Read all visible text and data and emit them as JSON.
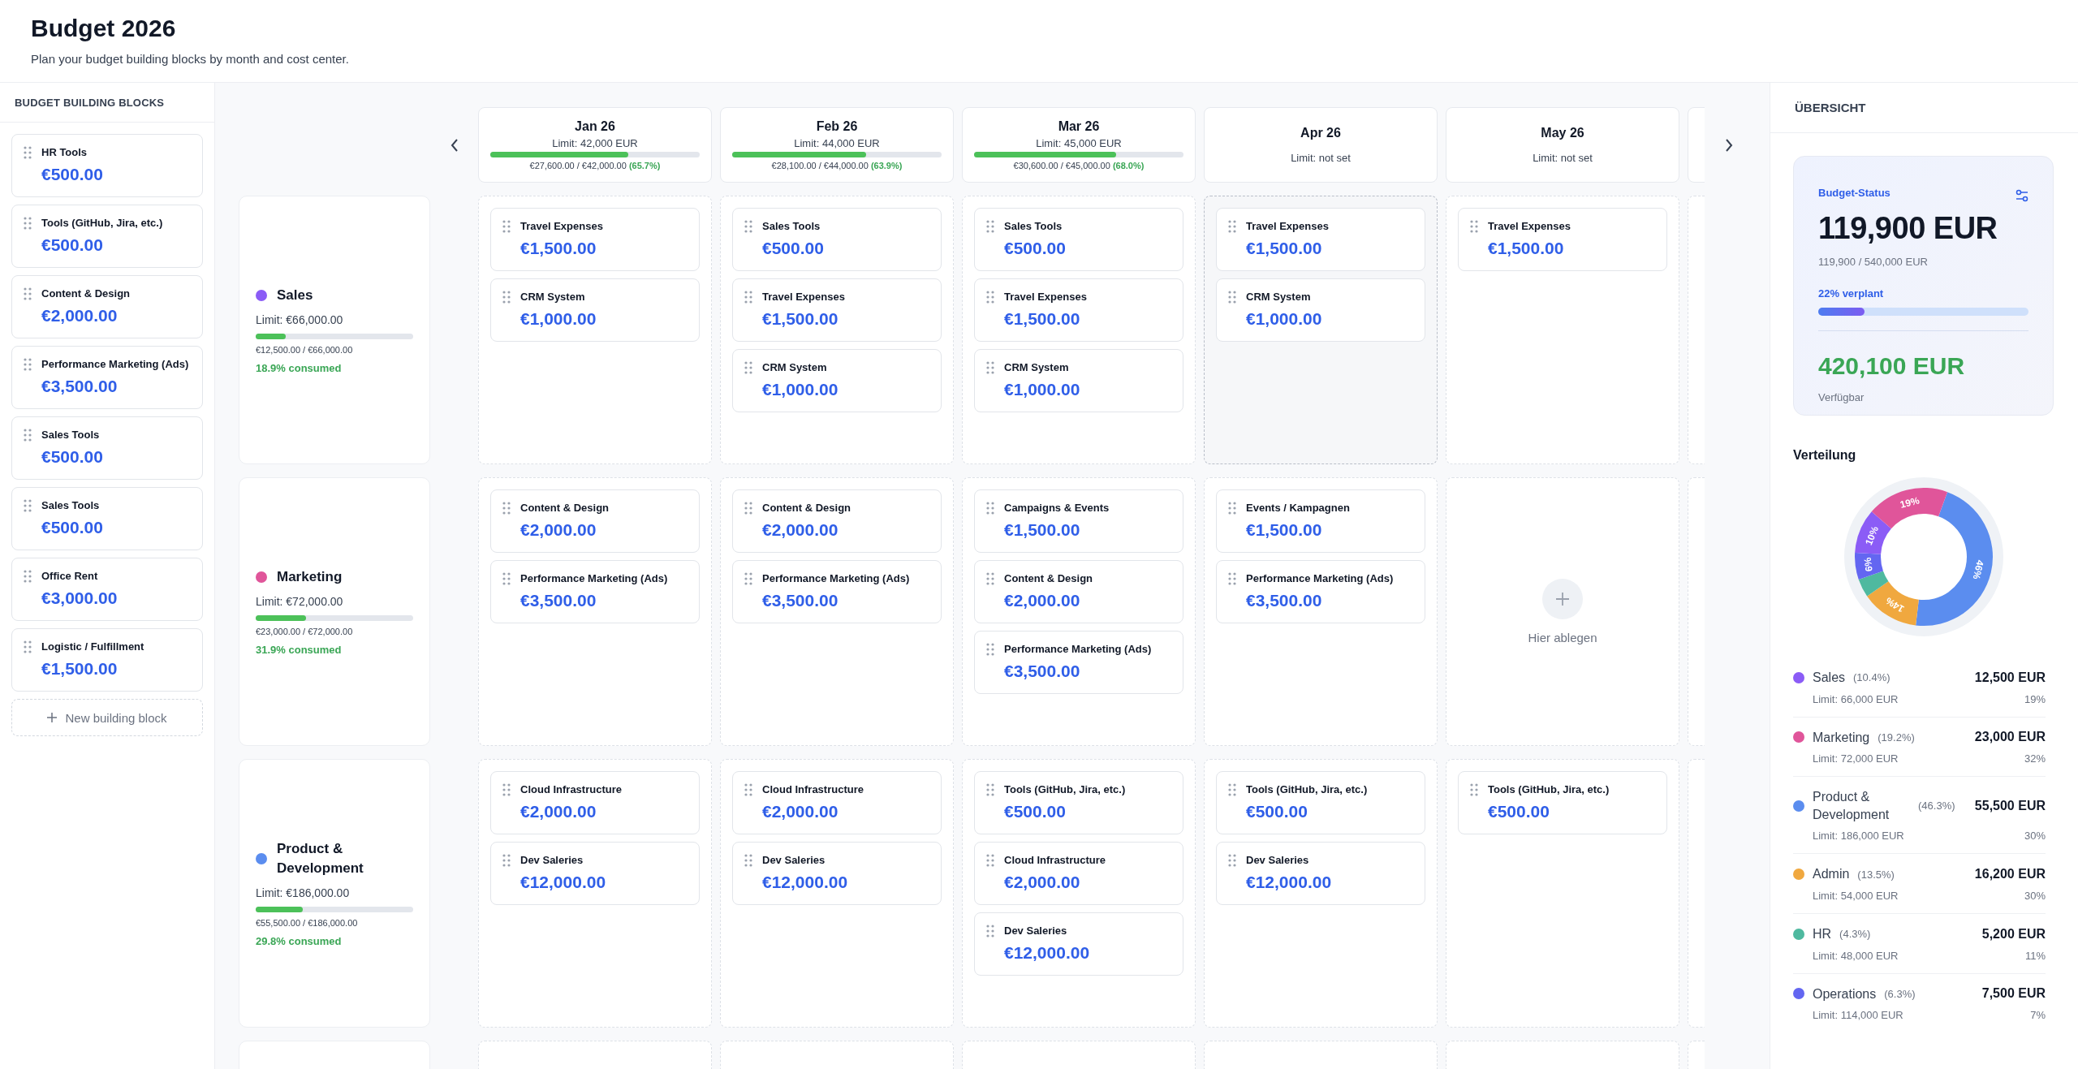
{
  "page": {
    "title": "Budget 2026",
    "subtitle": "Plan your budget building blocks by month and cost center."
  },
  "sidebar": {
    "title": "BUDGET BUILDING BLOCKS",
    "blocks": [
      {
        "label": "HR Tools",
        "amount": "€500.00"
      },
      {
        "label": "Tools (GitHub, Jira, etc.)",
        "amount": "€500.00"
      },
      {
        "label": "Content & Design",
        "amount": "€2,000.00"
      },
      {
        "label": "Performance Marketing (Ads)",
        "amount": "€3,500.00"
      },
      {
        "label": "Sales Tools",
        "amount": "€500.00"
      },
      {
        "label": "Sales Tools",
        "amount": "€500.00"
      },
      {
        "label": "Office Rent",
        "amount": "€3,000.00"
      },
      {
        "label": "Logistic / Fulfillment",
        "amount": "€1,500.00"
      }
    ],
    "new_button": "New building block"
  },
  "months": [
    {
      "title": "Jan 26",
      "limit": "Limit: 42,000 EUR",
      "level": 0.657,
      "reading": "€27,600.00 / €42,000.00",
      "percent": "(65.7%)"
    },
    {
      "title": "Feb 26",
      "limit": "Limit: 44,000 EUR",
      "level": 0.639,
      "reading": "€28,100.00 / €44,000.00",
      "percent": "(63.9%)"
    },
    {
      "title": "Mar 26",
      "limit": "Limit: 45,000 EUR",
      "level": 0.68,
      "reading": "€30,600.00 / €45,000.00",
      "percent": "(68.0%)"
    },
    {
      "title": "Apr 26",
      "limit": "Limit: not set"
    },
    {
      "title": "May 26",
      "limit": "Limit: not set"
    }
  ],
  "rows": [
    {
      "name": "Sales",
      "color": "#8b5cf6",
      "limit": "Limit: €66,000.00",
      "level": 0.189,
      "reading": "€12,500.00 / €66,000.00",
      "consumed": "18.9% consumed",
      "cells": [
        {
          "highlighted": false,
          "blocks": [
            {
              "label": "Travel Expenses",
              "amount": "€1,500.00"
            },
            {
              "label": "CRM System",
              "amount": "€1,000.00"
            }
          ]
        },
        {
          "highlighted": false,
          "blocks": [
            {
              "label": "Sales Tools",
              "amount": "€500.00"
            },
            {
              "label": "Travel Expenses",
              "amount": "€1,500.00"
            },
            {
              "label": "CRM System",
              "amount": "€1,000.00"
            }
          ]
        },
        {
          "highlighted": false,
          "blocks": [
            {
              "label": "Sales Tools",
              "amount": "€500.00"
            },
            {
              "label": "Travel Expenses",
              "amount": "€1,500.00"
            },
            {
              "label": "CRM System",
              "amount": "€1,000.00"
            }
          ]
        },
        {
          "highlighted": true,
          "blocks": [
            {
              "label": "Travel Expenses",
              "amount": "€1,500.00"
            },
            {
              "label": "CRM System",
              "amount": "€1,000.00"
            }
          ]
        },
        {
          "highlighted": false,
          "blocks": [
            {
              "label": "Travel Expenses",
              "amount": "€1,500.00"
            }
          ]
        }
      ]
    },
    {
      "name": "Marketing",
      "color": "#e0559a",
      "limit": "Limit: €72,000.00",
      "level": 0.319,
      "reading": "€23,000.00 / €72,000.00",
      "consumed": "31.9% consumed",
      "cells": [
        {
          "highlighted": false,
          "blocks": [
            {
              "label": "Content & Design",
              "amount": "€2,000.00"
            },
            {
              "label": "Performance Marketing (Ads)",
              "amount": "€3,500.00"
            }
          ]
        },
        {
          "highlighted": false,
          "blocks": [
            {
              "label": "Content & Design",
              "amount": "€2,000.00"
            },
            {
              "label": "Performance Marketing (Ads)",
              "amount": "€3,500.00"
            }
          ]
        },
        {
          "highlighted": false,
          "blocks": [
            {
              "label": "Campaigns & Events",
              "amount": "€1,500.00"
            },
            {
              "label": "Content & Design",
              "amount": "€2,000.00"
            },
            {
              "label": "Performance Marketing (Ads)",
              "amount": "€3,500.00"
            }
          ]
        },
        {
          "highlighted": false,
          "blocks": [
            {
              "label": "Events / Kampagnen",
              "amount": "€1,500.00"
            },
            {
              "label": "Performance Marketing (Ads)",
              "amount": "€3,500.00"
            }
          ]
        },
        {
          "highlighted": false,
          "hint": "Hier ablegen"
        }
      ]
    },
    {
      "name": "Product & Development",
      "color": "#5b8def",
      "limit": "Limit: €186,000.00",
      "level": 0.298,
      "reading": "€55,500.00 / €186,000.00",
      "consumed": "29.8% consumed",
      "cells": [
        {
          "highlighted": false,
          "blocks": [
            {
              "label": "Cloud Infrastructure",
              "amount": "€2,000.00"
            },
            {
              "label": "Dev Saleries",
              "amount": "€12,000.00"
            }
          ]
        },
        {
          "highlighted": false,
          "blocks": [
            {
              "label": "Cloud Infrastructure",
              "amount": "€2,000.00"
            },
            {
              "label": "Dev Saleries",
              "amount": "€12,000.00"
            }
          ]
        },
        {
          "highlighted": false,
          "blocks": [
            {
              "label": "Tools (GitHub, Jira, etc.)",
              "amount": "€500.00"
            },
            {
              "label": "Cloud Infrastructure",
              "amount": "€2,000.00"
            },
            {
              "label": "Dev Saleries",
              "amount": "€12,000.00"
            }
          ]
        },
        {
          "highlighted": false,
          "blocks": [
            {
              "label": "Tools (GitHub, Jira, etc.)",
              "amount": "€500.00"
            },
            {
              "label": "Dev Saleries",
              "amount": "€12,000.00"
            }
          ]
        },
        {
          "highlighted": false,
          "blocks": [
            {
              "label": "Tools (GitHub, Jira, etc.)",
              "amount": "€500.00"
            }
          ]
        }
      ]
    }
  ],
  "overview": {
    "title": "ÜBERSICHT",
    "status": {
      "title": "Budget-Status",
      "total": "119,900 EUR",
      "ratio": "119,900 / 540,000 EUR",
      "planned": "22% verplant",
      "level": 0.22,
      "available": "420,100 EUR",
      "available_label": "Verfügbar"
    },
    "distribution_title": "Verteilung",
    "chart_data": {
      "type": "donut",
      "series": [
        {
          "colors": [
            "#5b8def",
            "#f0a83f",
            "#4fb99f",
            "#6366f1",
            "#8b5cf6",
            "#e0559a"
          ],
          "values": [
            46.3,
            13.5,
            4.3,
            6.3,
            10.4,
            19.2
          ]
        }
      ],
      "value_labels": [
        "46%",
        "14%",
        null,
        "6%",
        "10%",
        "19%"
      ]
    },
    "legend": [
      {
        "name": "Sales",
        "share": "(10.4%)",
        "amount": "12,500 EUR",
        "limit": "Limit: 66,000 EUR",
        "percent": "19%",
        "color": "#8b5cf6"
      },
      {
        "name": "Marketing",
        "share": "(19.2%)",
        "amount": "23,000 EUR",
        "limit": "Limit: 72,000 EUR",
        "percent": "32%",
        "color": "#e0559a"
      },
      {
        "name": "Product & Development",
        "share": "(46.3%)",
        "amount": "55,500 EUR",
        "limit": "Limit: 186,000 EUR",
        "percent": "30%",
        "color": "#5b8def"
      },
      {
        "name": "Admin",
        "share": "(13.5%)",
        "amount": "16,200 EUR",
        "limit": "Limit: 54,000 EUR",
        "percent": "30%",
        "color": "#f0a83f"
      },
      {
        "name": "HR",
        "share": "(4.3%)",
        "amount": "5,200 EUR",
        "limit": "Limit: 48,000 EUR",
        "percent": "11%",
        "color": "#4fb99f"
      },
      {
        "name": "Operations",
        "share": "(6.3%)",
        "amount": "7,500 EUR",
        "limit": "Limit: 114,000 EUR",
        "percent": "7%",
        "color": "#6366f1"
      }
    ]
  }
}
